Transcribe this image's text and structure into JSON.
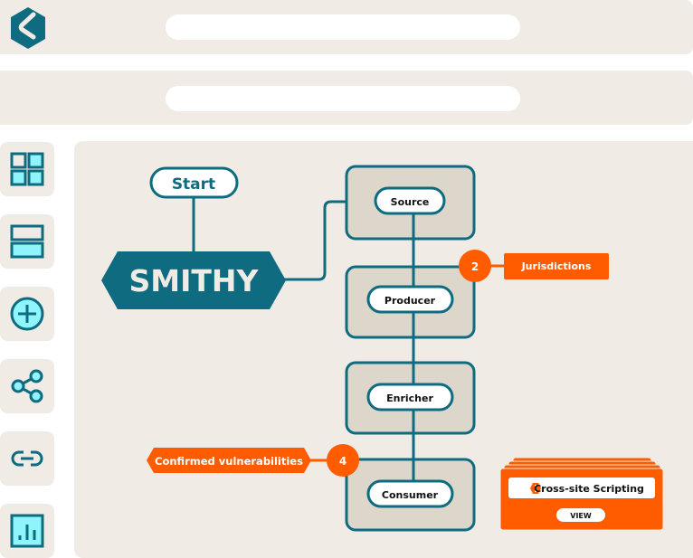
{
  "header": {
    "logo": "smithy-logo-icon",
    "search_primary": {
      "value": "",
      "placeholder": ""
    },
    "search_secondary": {
      "value": "",
      "placeholder": ""
    }
  },
  "sidebar": {
    "items": [
      {
        "name": "dashboard",
        "icon": "grid-icon"
      },
      {
        "name": "layout",
        "icon": "rows-icon"
      },
      {
        "name": "add",
        "icon": "plus-circle-icon"
      },
      {
        "name": "share",
        "icon": "share-icon"
      },
      {
        "name": "link",
        "icon": "link-icon"
      },
      {
        "name": "reports",
        "icon": "bar-chart-icon"
      }
    ]
  },
  "diagram": {
    "start_label": "Start",
    "brand_label": "SMITHY",
    "stages": [
      {
        "label": "Source"
      },
      {
        "label": "Producer"
      },
      {
        "label": "Enricher"
      },
      {
        "label": "Consumer"
      }
    ],
    "callouts": {
      "jurisdictions": {
        "count": "2",
        "label": "Jurisdictions"
      },
      "vulnerabilities": {
        "count": "4",
        "label": "Confirmed vulnerabilities"
      }
    },
    "finding_card": {
      "title": "Cross-site Scripting",
      "warning_icon": "alert-icon",
      "button_label": "VIEW"
    }
  },
  "colors": {
    "teal": "#0e6b80",
    "orange": "#ff5c00",
    "panel": "#f0ebe4",
    "stage_fill": "#ddd6cb",
    "icon_fill": "#8ff4fb"
  }
}
